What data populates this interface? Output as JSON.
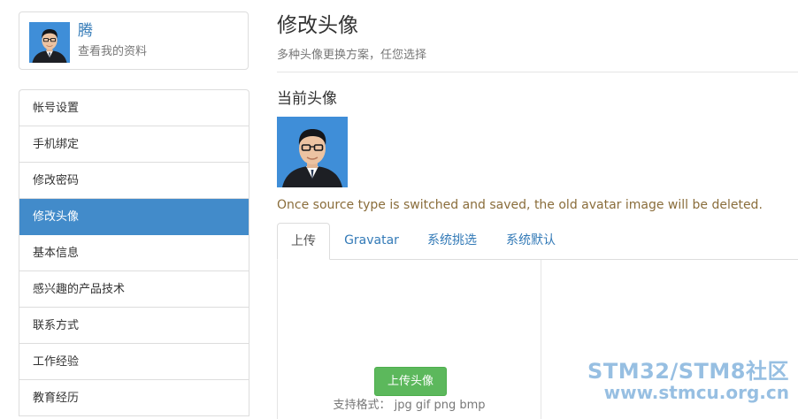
{
  "profile": {
    "name": "腾",
    "view_profile": "查看我的资料"
  },
  "sidebar": {
    "items": [
      {
        "label": "帐号设置"
      },
      {
        "label": "手机绑定"
      },
      {
        "label": "修改密码"
      },
      {
        "label": "修改头像",
        "active": true
      },
      {
        "label": "基本信息"
      },
      {
        "label": "感兴趣的产品技术"
      },
      {
        "label": "联系方式"
      },
      {
        "label": "工作经验"
      },
      {
        "label": "教育经历"
      }
    ]
  },
  "main": {
    "title": "修改头像",
    "subtitle": "多种头像更换方案，任您选择",
    "current_avatar_heading": "当前头像",
    "notice": "Once source type is switched and saved, the old avatar image will be deleted.",
    "tabs": [
      {
        "label": "上传",
        "active": true
      },
      {
        "label": "Gravatar"
      },
      {
        "label": "系统挑选"
      },
      {
        "label": "系统默认"
      }
    ],
    "upload": {
      "button_label": "上传头像",
      "formats": "支持格式： jpg gif png bmp"
    }
  },
  "watermark": {
    "line1": "STM32/STM8社区",
    "line2": "www.stmcu.org.cn"
  },
  "colors": {
    "accent": "#428bca",
    "link": "#337ab7",
    "success": "#5cb85c",
    "warning_text": "#8a6d3b"
  }
}
